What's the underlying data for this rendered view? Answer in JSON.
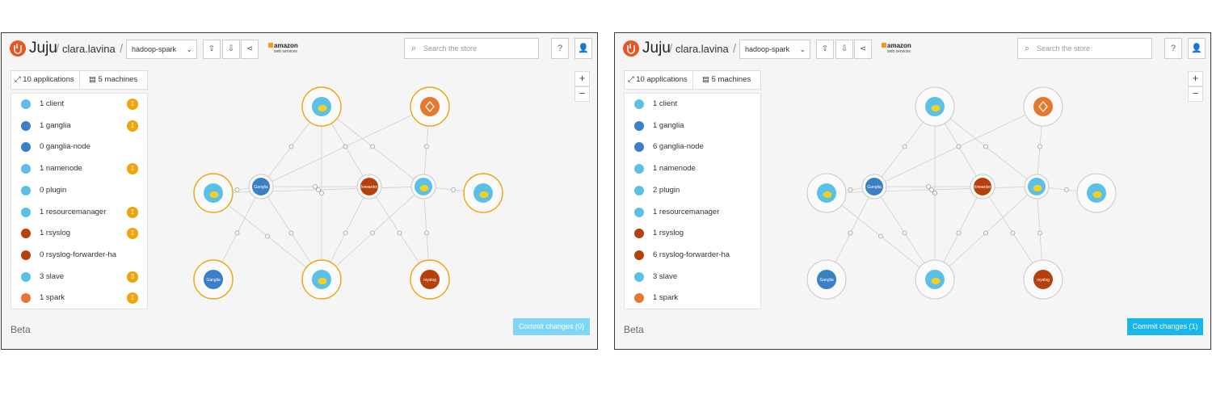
{
  "colors": {
    "accent_orange": "#f0a30a",
    "commit_blue": "#19b6ee",
    "commit_blue_disabled": "#7fd6f6",
    "brand": "#e95420"
  },
  "panels": [
    {
      "header": {
        "logo_text": "Juju",
        "separator": "/",
        "user": "clara.lavina",
        "model": "hadoop-spark",
        "model_chevron": "⌄",
        "aws_text": "amazon",
        "aws_sub": "web services",
        "search_placeholder": "Search the store",
        "help_icon": "?",
        "user_icon": "user-icon"
      },
      "tabs": {
        "applications": "10 applications",
        "machines": "5 machines"
      },
      "applications": [
        {
          "label": "1 client",
          "badge": "1",
          "icon": "hadoop-icon"
        },
        {
          "label": "1 ganglia",
          "badge": "1",
          "icon": "ganglia-icon"
        },
        {
          "label": "0 ganglia-node",
          "badge": "",
          "icon": "ganglia-icon"
        },
        {
          "label": "1 namenode",
          "badge": "1",
          "icon": "hadoop-icon"
        },
        {
          "label": "0 plugin",
          "badge": "",
          "icon": "hadoop-icon"
        },
        {
          "label": "1 resourcemanager",
          "badge": "1",
          "icon": "hadoop-icon"
        },
        {
          "label": "1 rsyslog",
          "badge": "1",
          "icon": "rsyslog-icon"
        },
        {
          "label": "0 rsyslog-forwarder-ha",
          "badge": "",
          "icon": "rsyslog-icon"
        },
        {
          "label": "3 slave",
          "badge": "3",
          "icon": "hadoop-icon"
        },
        {
          "label": "1 spark",
          "badge": "1",
          "icon": "spark-icon"
        }
      ],
      "zoom_in": "+",
      "zoom_out": "−",
      "beta": "Beta",
      "commit": "Commit changes (0)",
      "node_labels": {
        "ganglia": "Ganglia",
        "rsyslog": "rsyslog",
        "forwarder": "forwarder"
      }
    },
    {
      "header": {
        "logo_text": "Juju",
        "separator": "/",
        "user": "clara.lavina",
        "model": "hadoop-spark",
        "model_chevron": "⌄",
        "aws_text": "amazon",
        "aws_sub": "web services",
        "search_placeholder": "Search the store",
        "help_icon": "?",
        "user_icon": "user-icon"
      },
      "tabs": {
        "applications": "10 applications",
        "machines": "5 machines"
      },
      "applications": [
        {
          "label": "1 client",
          "badge": "",
          "icon": "hadoop-icon"
        },
        {
          "label": "1 ganglia",
          "badge": "",
          "icon": "ganglia-icon"
        },
        {
          "label": "6 ganglia-node",
          "badge": "",
          "icon": "ganglia-icon"
        },
        {
          "label": "1 namenode",
          "badge": "",
          "icon": "hadoop-icon"
        },
        {
          "label": "2 plugin",
          "badge": "",
          "icon": "hadoop-icon"
        },
        {
          "label": "1 resourcemanager",
          "badge": "",
          "icon": "hadoop-icon"
        },
        {
          "label": "1 rsyslog",
          "badge": "",
          "icon": "rsyslog-icon"
        },
        {
          "label": "6 rsyslog-forwarder-ha",
          "badge": "",
          "icon": "rsyslog-icon"
        },
        {
          "label": "3 slave",
          "badge": "",
          "icon": "hadoop-icon"
        },
        {
          "label": "1 spark",
          "badge": "",
          "icon": "spark-icon"
        }
      ],
      "zoom_in": "+",
      "zoom_out": "−",
      "beta": "Beta",
      "commit": "Commit changes (1)",
      "node_labels": {
        "ganglia": "Ganglia",
        "rsyslog": "rsyslog",
        "forwarder": "forwarder"
      }
    }
  ]
}
